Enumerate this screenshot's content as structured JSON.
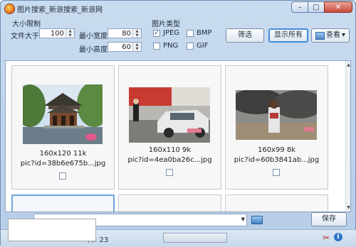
{
  "window": {
    "title": "图片搜索_新浪搜索_新浪网",
    "minimize": "–",
    "maximize": "□",
    "close": "✕"
  },
  "toolbar": {
    "size_group": "大小限制",
    "file_size_label": "文件大于",
    "file_size_value": "100",
    "min_width_label": "最小宽度",
    "min_width_value": "80",
    "min_height_label": "最小高度",
    "min_height_value": "60",
    "type_group": "图片类型",
    "types": [
      {
        "label": "JPEG",
        "checked": "✓"
      },
      {
        "label": "BMP",
        "checked": ""
      },
      {
        "label": "PNG",
        "checked": ""
      },
      {
        "label": "GIF",
        "checked": ""
      }
    ],
    "filter_button": "筛选",
    "show_all_button": "显示所有",
    "view_button": "查看",
    "view_arrow": "▾"
  },
  "images": [
    {
      "dims": "160x120 11k",
      "name": "pic?id=38b6e675b...jpg"
    },
    {
      "dims": "160x110 9k",
      "name": "pic?id=4ea0ba26c...jpg"
    },
    {
      "dims": "160x99 8k",
      "name": "pic?id=60b3841ab...jpg"
    }
  ],
  "scroll": {
    "up": "▲",
    "down": "▼"
  },
  "bottom": {
    "combo_arrow": "▼",
    "save_button": "保存"
  },
  "status": {
    "count_text": "片: 23"
  },
  "colors": {
    "accent": "#3d8de0",
    "window_frame": "#c9dbef"
  }
}
